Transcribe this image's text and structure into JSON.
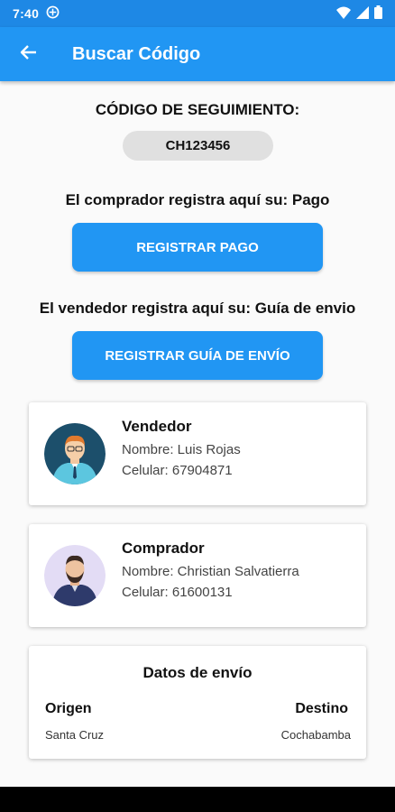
{
  "status_bar": {
    "time": "7:40"
  },
  "app_bar": {
    "title": "Buscar Código"
  },
  "tracking": {
    "label": "CÓDIGO DE SEGUIMIENTO:",
    "code": "CH123456"
  },
  "buyer_section": {
    "prompt": "El comprador registra aquí su: Pago",
    "button_label": "REGISTRAR PAGO"
  },
  "seller_section": {
    "prompt": "El vendedor registra aquí su: Guía de envio",
    "button_label": "REGISTRAR GUÍA DE ENVÍO"
  },
  "seller_card": {
    "role": "Vendedor",
    "name": "Nombre: Luis Rojas",
    "phone": "Celular: 67904871"
  },
  "buyer_card": {
    "role": "Comprador",
    "name": "Nombre: Christian Salvatierra",
    "phone": "Celular: 61600131"
  },
  "shipping": {
    "title": "Datos de envío",
    "origin_label": "Origen",
    "origin_value": "Santa Cruz",
    "destination_label": "Destino",
    "destination_value": "Cochabamba"
  },
  "colors": {
    "app_bar": "#2196f3",
    "status_bar": "#1e88e5",
    "button": "#2196f3",
    "pill": "#e0e0e0"
  },
  "icons": {
    "back": "arrow-back-icon",
    "status_app": "app-notification-icon",
    "wifi": "wifi-icon",
    "signal": "cell-signal-icon",
    "battery": "battery-icon"
  }
}
